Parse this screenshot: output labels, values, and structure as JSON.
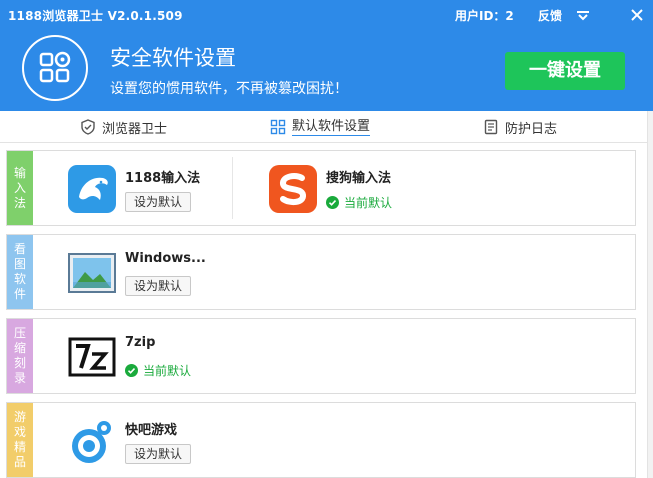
{
  "titlebar": {
    "app_title": "1188浏览器卫士 V2.0.1.509",
    "user_id": "用户ID：2",
    "feedback": "反馈"
  },
  "header": {
    "title": "安全软件设置",
    "subtitle": "设置您的惯用软件，不再被篡改困扰！",
    "one_key_button": "一键设置"
  },
  "tabs": [
    {
      "label": "浏览器卫士",
      "icon": "shield-icon"
    },
    {
      "label": "默认软件设置",
      "icon": "grid-icon",
      "active": true
    },
    {
      "label": "防护日志",
      "icon": "log-icon"
    }
  ],
  "categories": [
    {
      "label": [
        "输",
        "入",
        "法"
      ],
      "color": "#7fd06b",
      "apps": [
        {
          "name": "1188输入法",
          "icon": "dolphin-icon",
          "action": "设为默认"
        },
        {
          "name": "搜狗输入法",
          "icon": "sogou-icon",
          "status": "当前默认"
        }
      ]
    },
    {
      "label": [
        "看",
        "图",
        "软",
        "件"
      ],
      "color": "#8ec5ef",
      "apps": [
        {
          "name": "Windows...",
          "icon": "photo-viewer-icon",
          "action": "设为默认"
        }
      ]
    },
    {
      "label": [
        "压",
        "缩",
        "刻",
        "录"
      ],
      "color": "#d8a8e0",
      "apps": [
        {
          "name": "7zip",
          "icon": "7zip-icon",
          "status": "当前默认"
        }
      ]
    },
    {
      "label": [
        "游",
        "戏",
        "精",
        "品"
      ],
      "color": "#f2cd6a",
      "apps": [
        {
          "name": "快吧游戏",
          "icon": "kuaiba-icon",
          "action": "设为默认"
        }
      ]
    }
  ],
  "colors": {
    "header_blue": "#2d8ae8",
    "accent_green": "#1ec55a",
    "status_green": "#1aaa3c"
  }
}
